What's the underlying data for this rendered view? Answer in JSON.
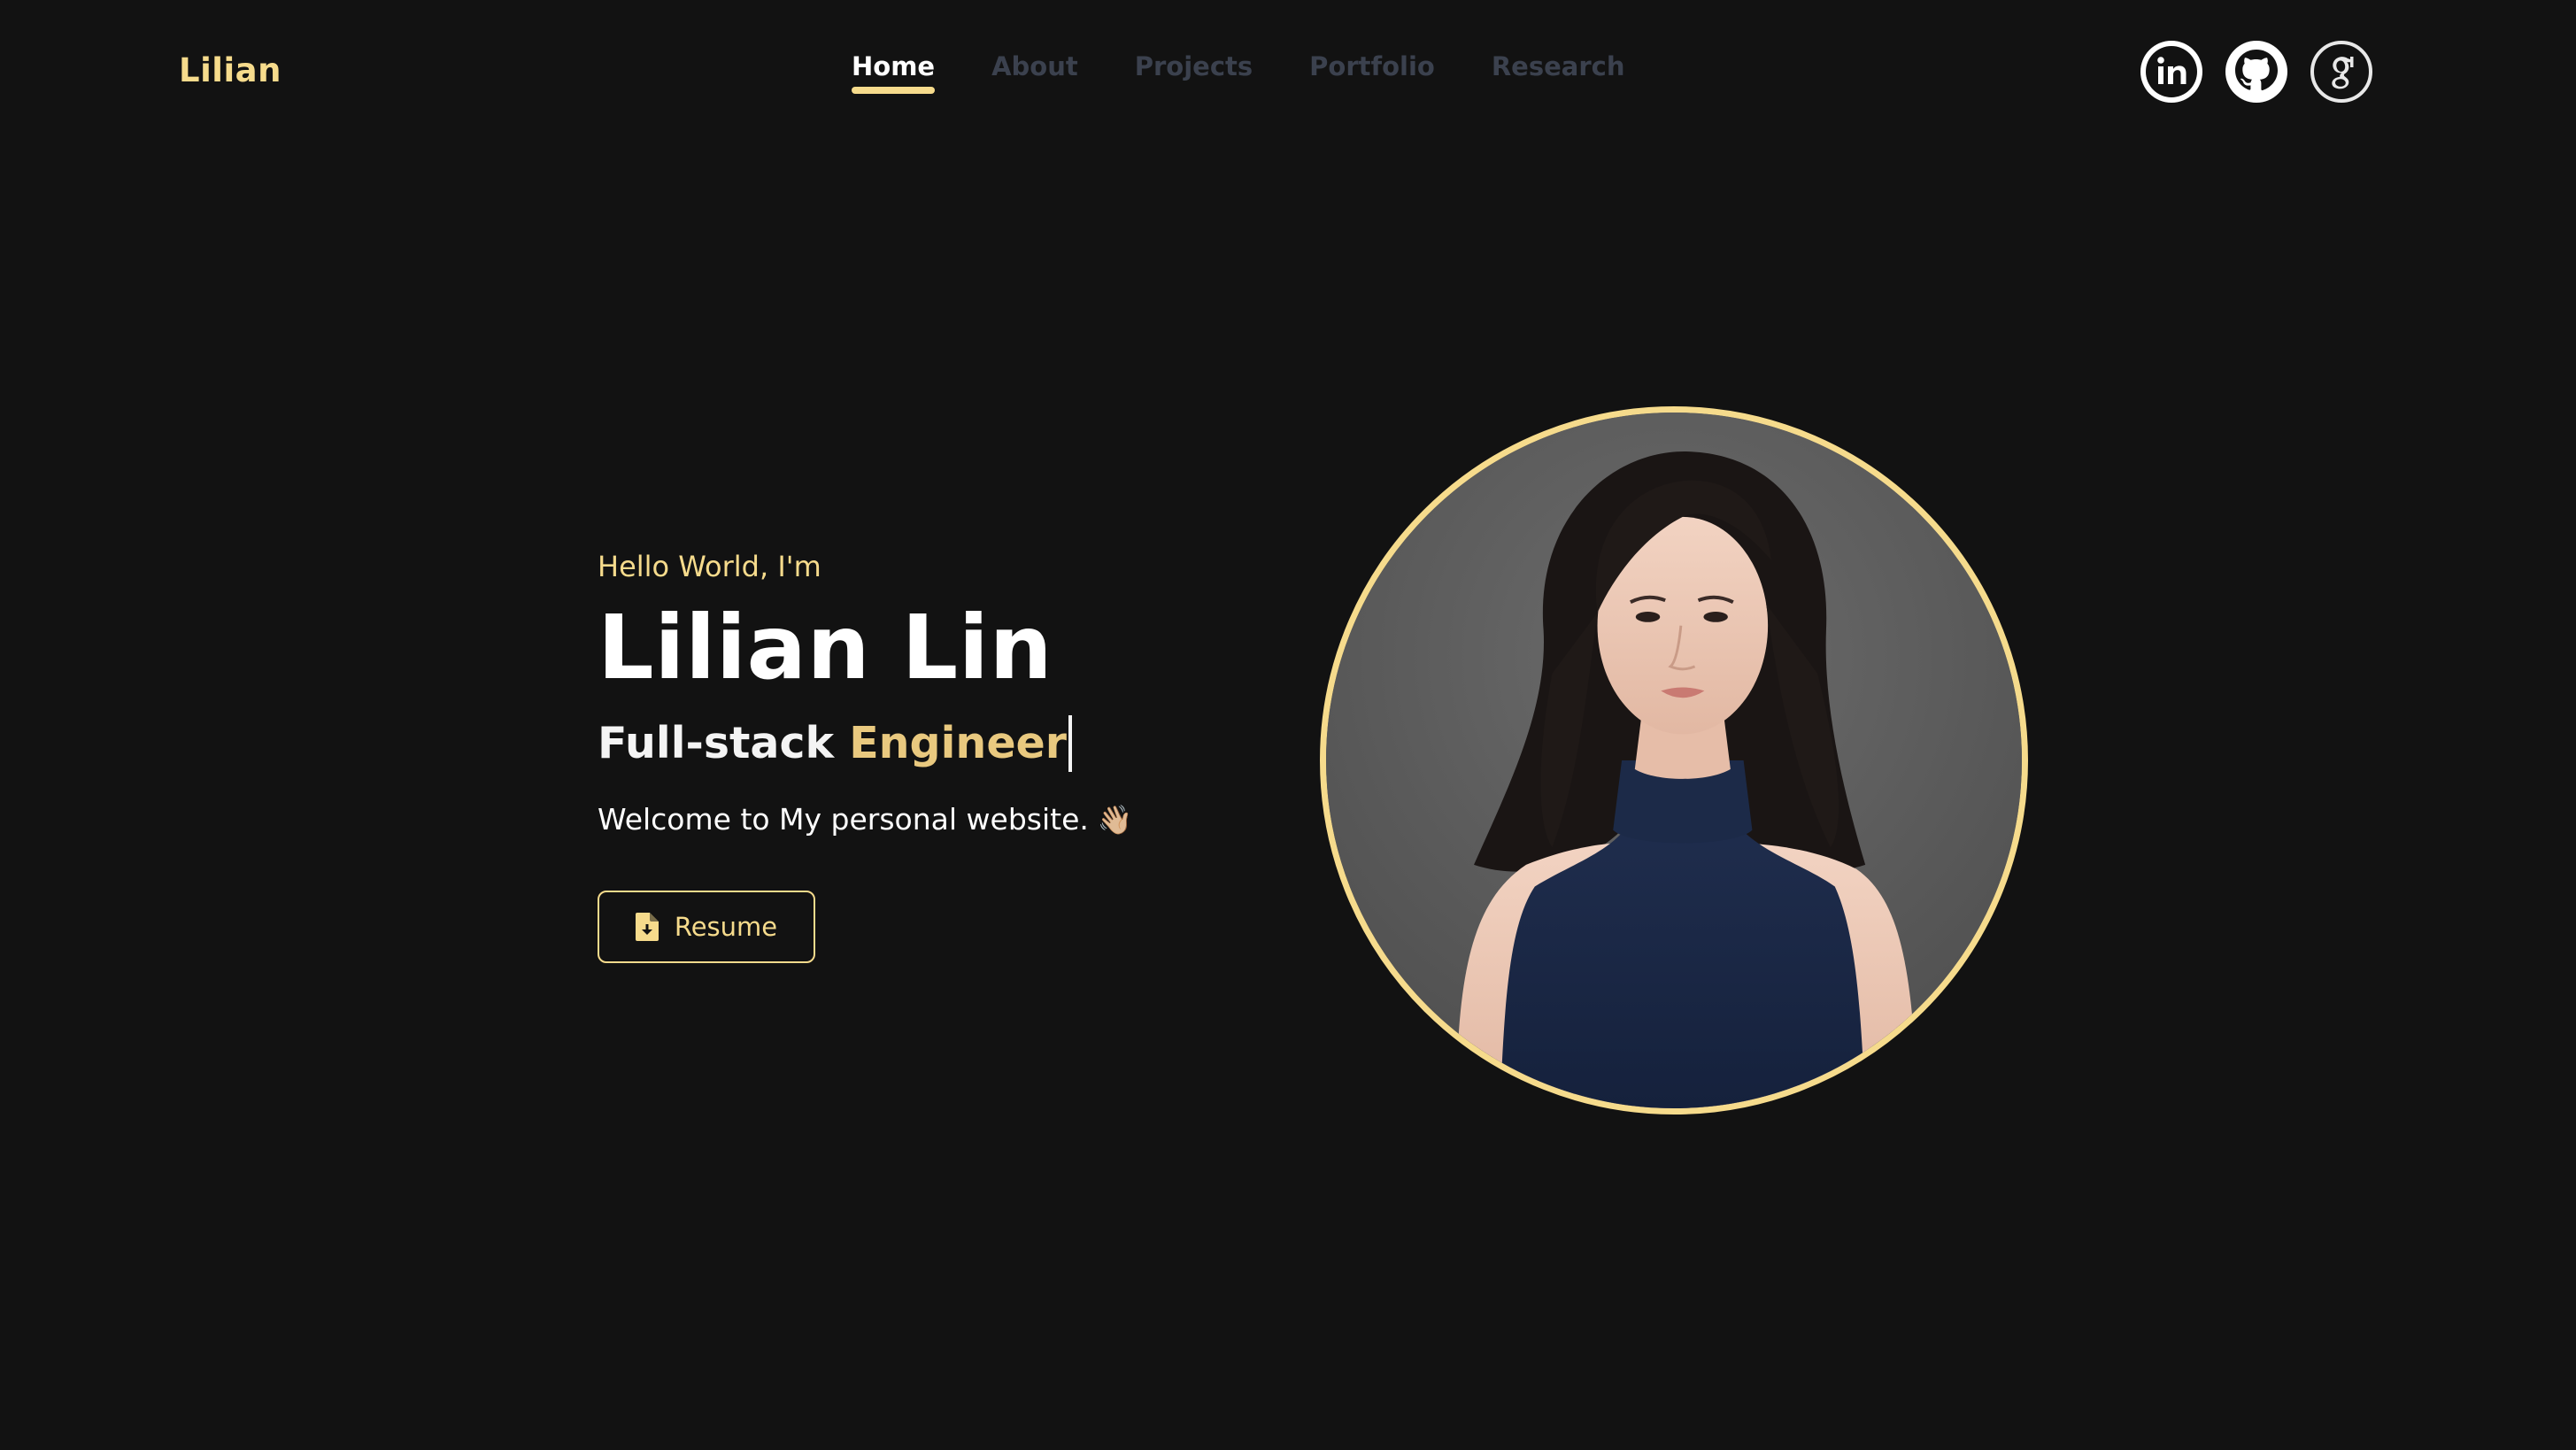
{
  "header": {
    "logo": "Lilian",
    "nav": [
      {
        "label": "Home",
        "active": true
      },
      {
        "label": "About",
        "active": false
      },
      {
        "label": "Projects",
        "active": false
      },
      {
        "label": "Portfolio",
        "active": false
      },
      {
        "label": "Research",
        "active": false
      }
    ],
    "social": [
      {
        "icon": "linkedin-icon"
      },
      {
        "icon": "github-icon"
      },
      {
        "icon": "google-scholar-icon"
      }
    ]
  },
  "hero": {
    "greeting": "Hello World, I'm",
    "name": "Lilian Lin",
    "role_prefix": "Full-stack",
    "role_highlight": "Engineer",
    "welcome": "Welcome to My personal website.",
    "wave_emoji": "👋🏼",
    "resume_label": "Resume",
    "resume_icon": "file-download-icon"
  },
  "portrait": {
    "icon": "profile-photo"
  },
  "colors": {
    "background": "#121212",
    "accent": "#f6db8c",
    "highlight": "#e9c97f",
    "nav_inactive": "#3b414e",
    "text": "#ffffff"
  }
}
